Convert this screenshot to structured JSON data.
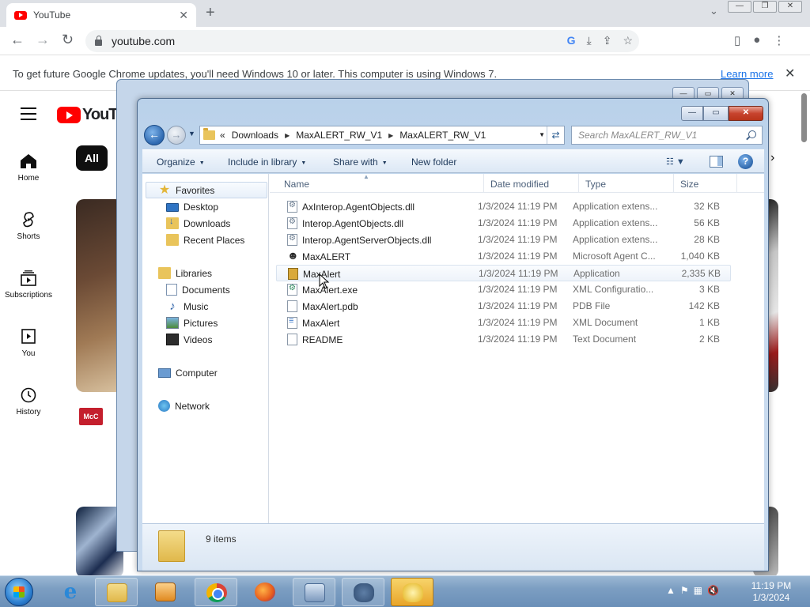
{
  "browser": {
    "tab_title": "YouTube",
    "tab_close": "✕",
    "new_tab": "+",
    "tab_dropdown": "⌄",
    "url": "youtube.com",
    "infobar_text": "To get future Google Chrome updates, you'll need Windows 10 or later. This computer is using Windows 7.",
    "infobar_link": "Learn more",
    "infobar_close": "✕",
    "icons": [
      "back-arrow-icon",
      "forward-arrow-icon",
      "reload-icon",
      "lock-icon",
      "google-icon",
      "install-icon",
      "share-icon",
      "bookmark-star-icon",
      "side-panel-icon",
      "profile-icon",
      "kebab-menu-icon"
    ]
  },
  "youtube": {
    "logo_text": "YouTu",
    "chip_all": "All",
    "sign_fragment": "n",
    "channel_badge": "McC",
    "sidebar": [
      {
        "label": "Home"
      },
      {
        "label": "Shorts"
      },
      {
        "label": "Subscriptions"
      },
      {
        "label": "You"
      },
      {
        "label": "History"
      }
    ]
  },
  "explorer": {
    "breadcrumb": [
      "Downloads",
      "MaxALERT_RW_V1",
      "MaxALERT_RW_V1"
    ],
    "breadcrumb_lead": "«",
    "search_placeholder": "Search MaxALERT_RW_V1",
    "toolbar": {
      "organize": "Organize",
      "include_in_library": "Include in library",
      "share_with": "Share with",
      "new_folder": "New folder",
      "help": "?"
    },
    "nav": {
      "favorites": "Favorites",
      "desktop": "Desktop",
      "downloads": "Downloads",
      "recent_places": "Recent Places",
      "libraries": "Libraries",
      "documents": "Documents",
      "music": "Music",
      "pictures": "Pictures",
      "videos": "Videos",
      "computer": "Computer",
      "network": "Network"
    },
    "columns": {
      "name": "Name",
      "date": "Date modified",
      "type": "Type",
      "size": "Size"
    },
    "files": [
      {
        "name": "AxInterop.AgentObjects.dll",
        "date": "1/3/2024 11:19 PM",
        "type": "Application extens...",
        "size": "32 KB",
        "icon": "dll-file-icon"
      },
      {
        "name": "Interop.AgentObjects.dll",
        "date": "1/3/2024 11:19 PM",
        "type": "Application extens...",
        "size": "56 KB",
        "icon": "dll-file-icon"
      },
      {
        "name": "Interop.AgentServerObjects.dll",
        "date": "1/3/2024 11:19 PM",
        "type": "Application extens...",
        "size": "28 KB",
        "icon": "dll-file-icon"
      },
      {
        "name": "MaxALERT",
        "date": "1/3/2024 11:19 PM",
        "type": "Microsoft Agent C...",
        "size": "1,040 KB",
        "icon": "agent-character-icon"
      },
      {
        "name": "MaxAlert",
        "date": "1/3/2024 11:19 PM",
        "type": "Application",
        "size": "2,335 KB",
        "icon": "application-icon"
      },
      {
        "name": "MaxAlert.exe",
        "date": "1/3/2024 11:19 PM",
        "type": "XML Configuratio...",
        "size": "3 KB",
        "icon": "config-file-icon"
      },
      {
        "name": "MaxAlert.pdb",
        "date": "1/3/2024 11:19 PM",
        "type": "PDB File",
        "size": "142 KB",
        "icon": "blank-file-icon"
      },
      {
        "name": "MaxAlert",
        "date": "1/3/2024 11:19 PM",
        "type": "XML Document",
        "size": "1 KB",
        "icon": "xml-file-icon"
      },
      {
        "name": "README",
        "date": "1/3/2024 11:19 PM",
        "type": "Text Document",
        "size": "2 KB",
        "icon": "text-file-icon"
      }
    ],
    "status_items": "9 items"
  },
  "taskbar": {
    "time": "11:19 PM",
    "date": "1/3/2024",
    "tray_arrow": "▲"
  }
}
